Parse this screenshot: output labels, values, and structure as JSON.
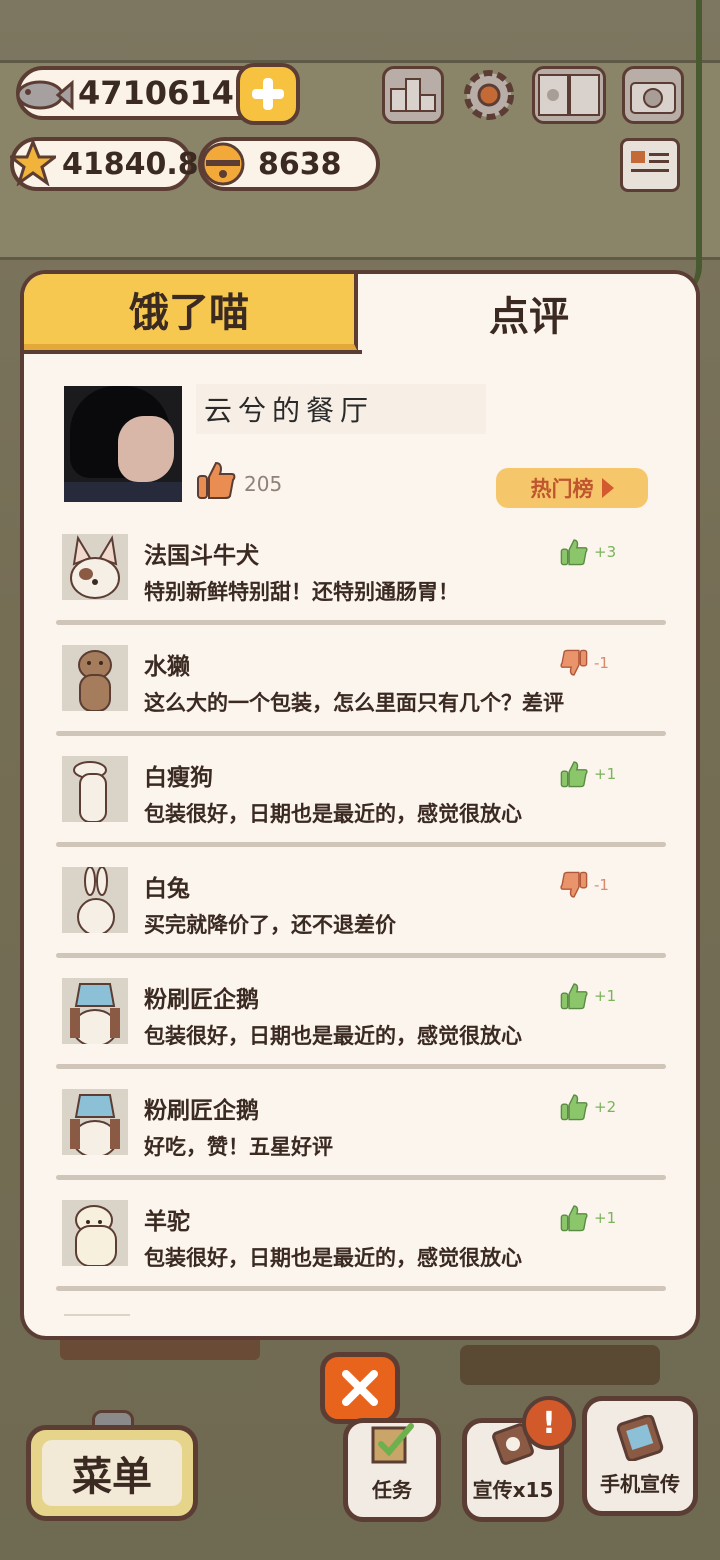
{
  "hud": {
    "fish_count": "4710614",
    "star_count": "41840.8",
    "bell_count": "8638"
  },
  "tabs": [
    {
      "label": "饿了喵",
      "active": false
    },
    {
      "label": "点评",
      "active": true
    }
  ],
  "profile": {
    "restaurant_name": "云兮的餐厅",
    "likes": "205",
    "hot_list_label": "热门榜"
  },
  "reviews": [
    {
      "name": "法国斗牛犬",
      "text": "特别新鲜特别甜！还特别通肠胃！",
      "vote": "+3",
      "type": "up"
    },
    {
      "name": "水獭",
      "text": "这么大的一个包装，怎么里面只有几个？差评",
      "vote": "-1",
      "type": "down"
    },
    {
      "name": "白瘦狗",
      "text": "包装很好，日期也是最近的，感觉很放心",
      "vote": "+1",
      "type": "up"
    },
    {
      "name": "白兔",
      "text": "买完就降价了，还不退差价",
      "vote": "-1",
      "type": "down"
    },
    {
      "name": "粉刷匠企鹅",
      "text": "包装很好，日期也是最近的，感觉很放心",
      "vote": "+1",
      "type": "up"
    },
    {
      "name": "粉刷匠企鹅",
      "text": "好吃，赞！五星好评",
      "vote": "+2",
      "type": "up"
    },
    {
      "name": "羊驼",
      "text": "包装很好，日期也是最近的，感觉很放心",
      "vote": "+1",
      "type": "up"
    }
  ],
  "bottom": {
    "menu_label": "菜单",
    "task_label": "任务",
    "promo_label": "宣传x15",
    "phone_promo_label": "手机宣传",
    "alert_mark": "!"
  },
  "icons": {
    "fish": "fish-icon",
    "star": "star-icon",
    "bell": "bell-icon",
    "plus": "plus-icon",
    "ranking": "ranking-icon",
    "gear": "gear-icon",
    "book": "book-icon",
    "camera": "camera-icon",
    "newspaper": "newspaper-icon",
    "thumb_up": "thumb-up-icon",
    "thumb_down": "thumb-down-icon",
    "close": "close-icon"
  },
  "colors": {
    "accent_yellow": "#f7c84f",
    "outline_brown": "#5b3d33",
    "panel_bg": "#fbf5ee",
    "vote_up": "#7ab35a",
    "vote_down": "#d88a6a",
    "close_orange": "#e8631c"
  }
}
